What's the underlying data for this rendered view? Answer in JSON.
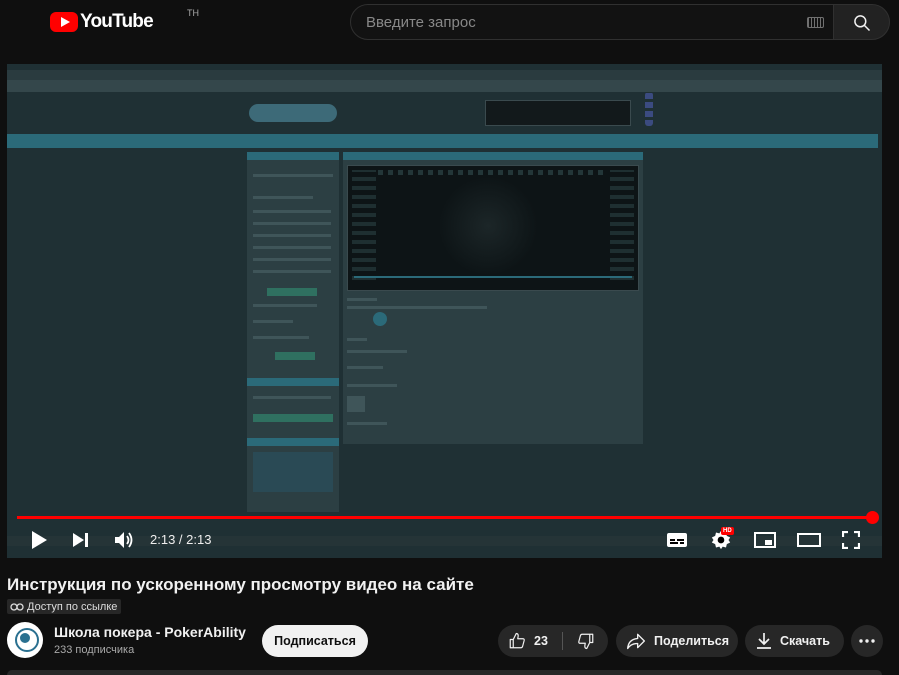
{
  "header": {
    "logo_text": "YouTube",
    "logo_region": "TH",
    "search_placeholder": "Введите запрос",
    "icons": [
      "keyboard-icon",
      "search-icon"
    ]
  },
  "player": {
    "time_display": "2:13 / 2:13",
    "progress": 1.0,
    "hd_label": "HD",
    "controls": [
      "play-icon",
      "next-icon",
      "volume-icon",
      "subtitles-icon",
      "settings-icon",
      "miniplayer-icon",
      "theater-icon",
      "fullscreen-icon"
    ]
  },
  "video": {
    "title": "Инструкция по ускоренному просмотру видео на сайте",
    "visibility": "Доступ по ссылке"
  },
  "channel": {
    "name": "Школа покера - PokerAbility",
    "subscribers": "233 подписчика",
    "subscribe_label": "Подписаться"
  },
  "actions": {
    "likes": "23",
    "share_label": "Поделиться",
    "download_label": "Скачать"
  },
  "colors": {
    "background": "#0f0f0f",
    "accent": "#ff0000",
    "pill": "#272727"
  }
}
